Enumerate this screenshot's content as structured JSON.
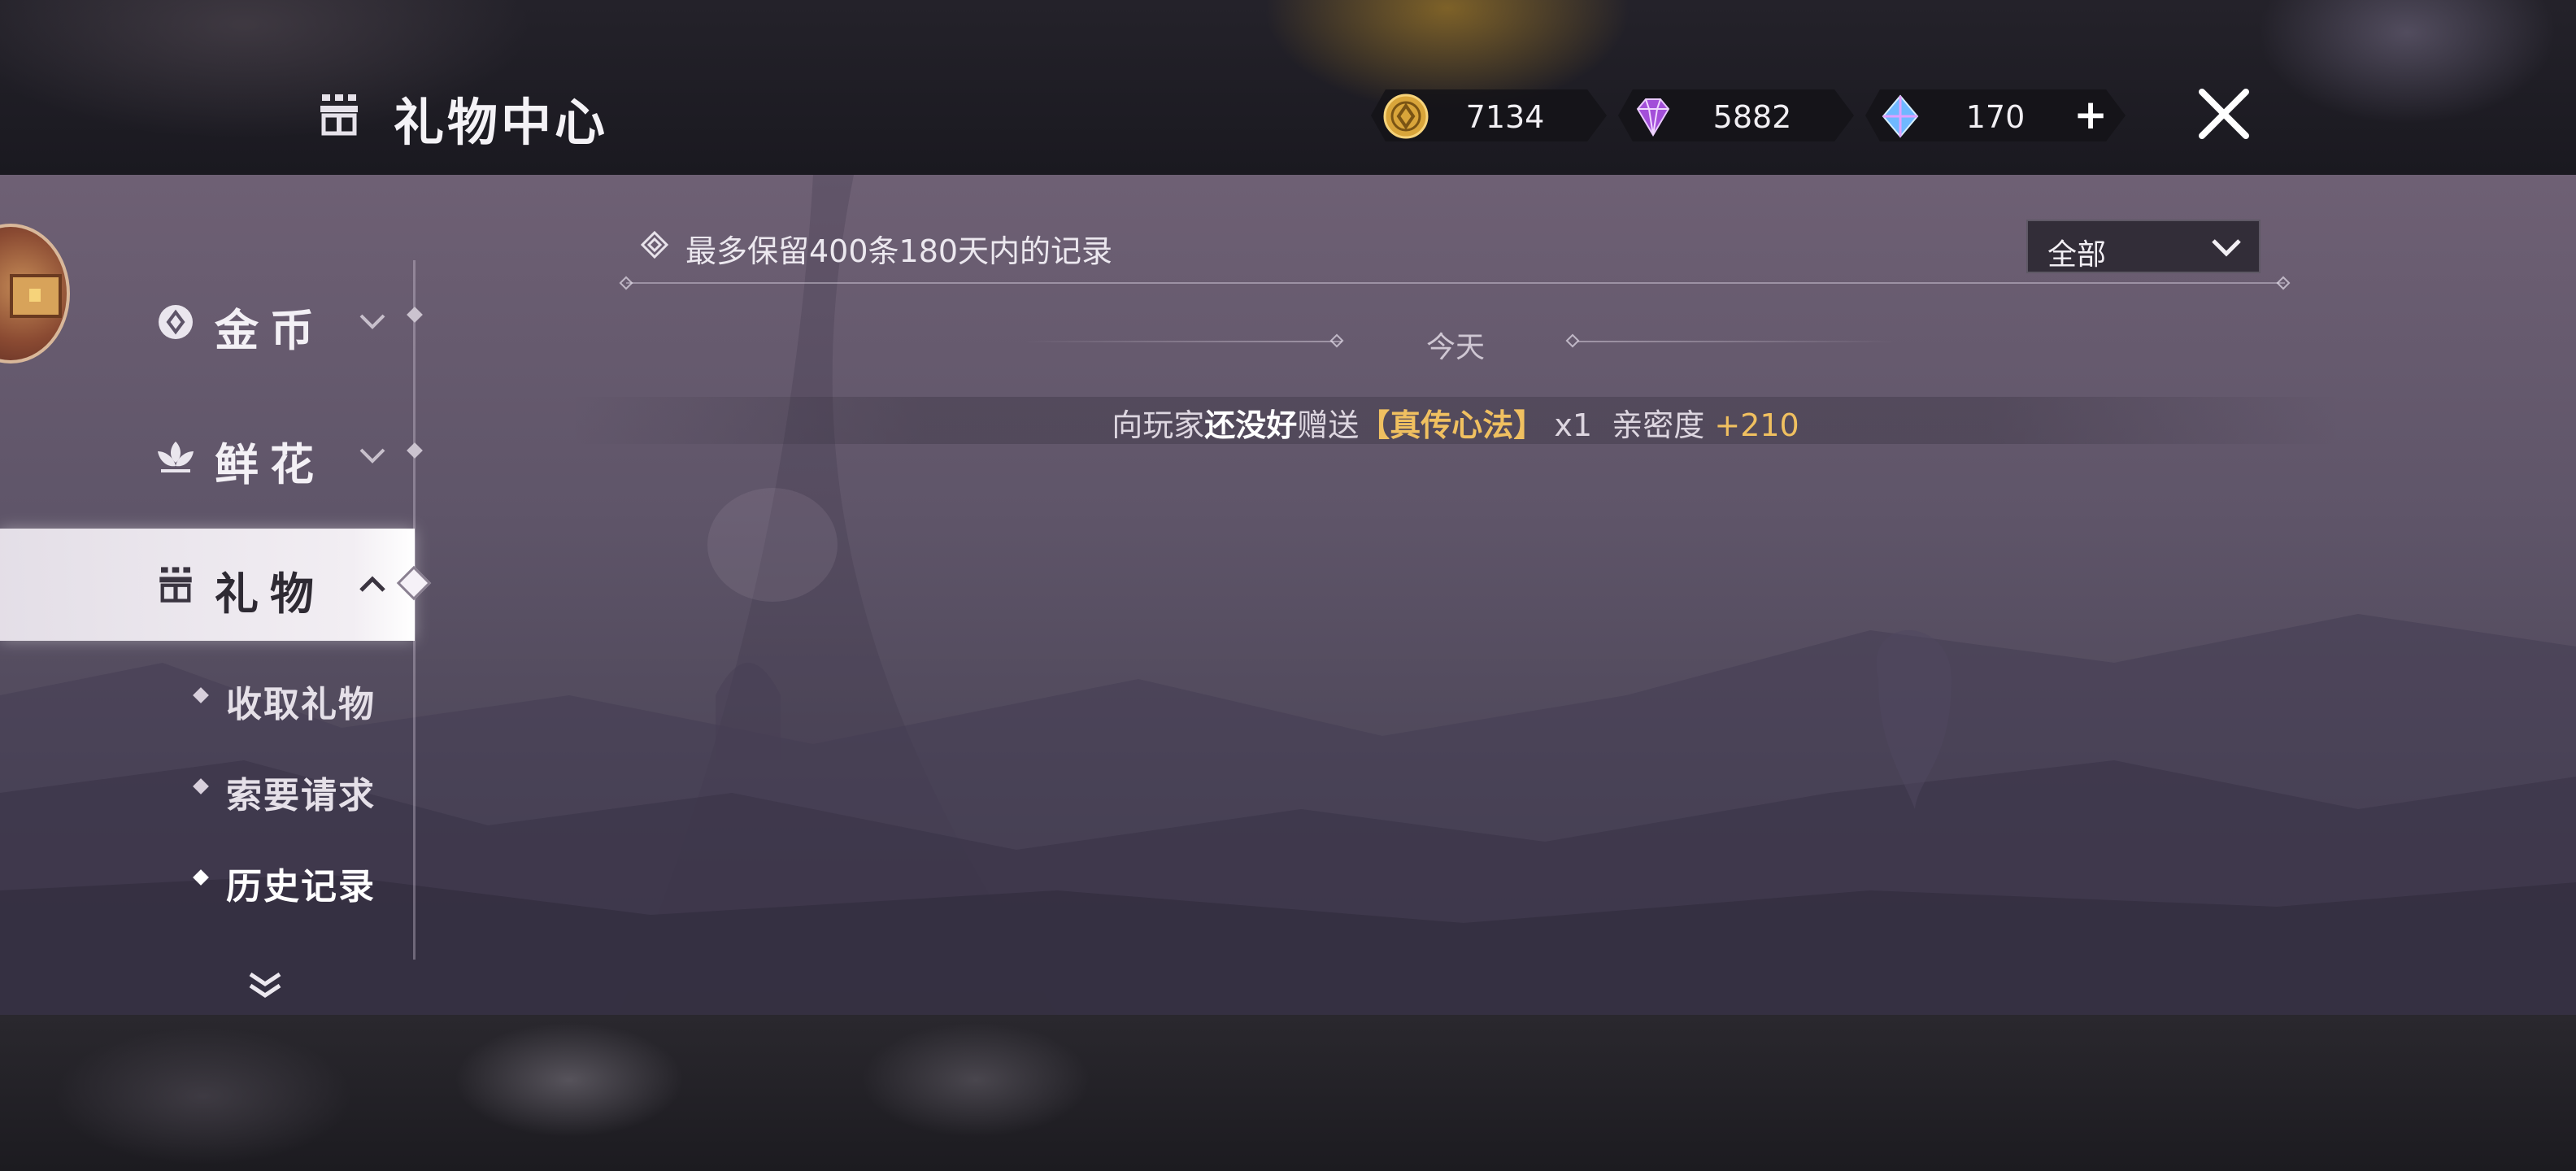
{
  "header": {
    "title": "礼物中心",
    "currencies": [
      {
        "icon": "gold-coin-icon",
        "value": "7134"
      },
      {
        "icon": "purple-gem-icon",
        "value": "5882"
      },
      {
        "icon": "blue-crystal-icon",
        "value": "170",
        "add_label": "+"
      }
    ]
  },
  "sidebar": {
    "menu": [
      {
        "label": "金币",
        "icon": "coin-icon",
        "expanded": false
      },
      {
        "label": "鲜花",
        "icon": "flower-icon",
        "expanded": false
      },
      {
        "label": "礼物",
        "icon": "gift-icon",
        "expanded": true
      }
    ],
    "submenu": [
      {
        "label": "收取礼物",
        "current": false
      },
      {
        "label": "索要请求",
        "current": false
      },
      {
        "label": "历史记录",
        "current": true
      }
    ]
  },
  "content": {
    "notice": "最多保留400条180天内的记录",
    "filter": {
      "selected": "全部"
    },
    "date_group": "今天",
    "records": [
      {
        "prefix": "向玩家",
        "player": "还没好",
        "action": "赠送",
        "item": "【真传心法】",
        "quantity": "x1",
        "stat_label": "亲密度",
        "stat_value": "+210"
      }
    ]
  },
  "colors": {
    "highlight": "#f0c060",
    "panel": "#5f5569",
    "accent_gold": "#d9a53a"
  }
}
